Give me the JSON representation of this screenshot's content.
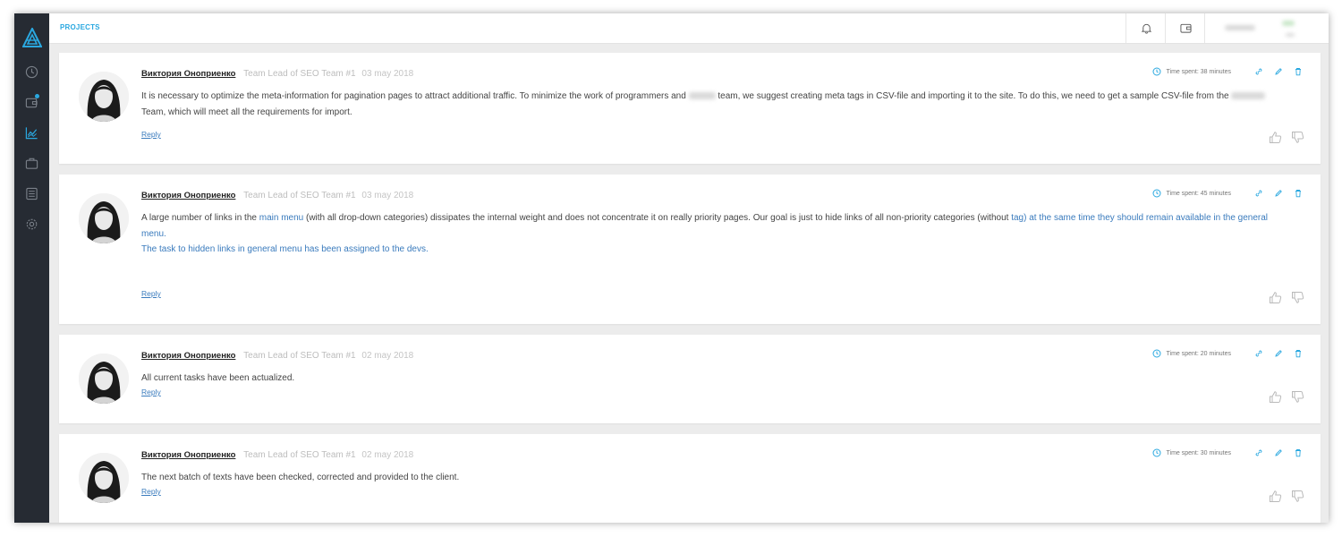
{
  "app": {
    "section_title": "PROJECTS",
    "accent_color": "#2aa8e0",
    "sidebar_bg": "#262b33"
  },
  "sidebar": {
    "items": [
      {
        "icon": "logo-icon"
      },
      {
        "icon": "clock-icon"
      },
      {
        "icon": "wallet-icon"
      },
      {
        "icon": "chart-icon",
        "active": true
      },
      {
        "icon": "briefcase-icon"
      },
      {
        "icon": "list-icon"
      },
      {
        "icon": "gear-icon"
      }
    ]
  },
  "topbar": {
    "icons": [
      "bell-icon",
      "wallet-icon"
    ]
  },
  "comments": [
    {
      "author": "Виктория Оноприенко",
      "role": "Team Lead of SEO Team #1",
      "date": "03 may 2018",
      "time_spent": "Time spent: 38 minutes",
      "text_parts": {
        "p1": "It is necessary to optimize the meta-information for pagination pages to attract additional traffic. To minimize the work of programmers and",
        "p2": "team, we suggest creating meta tags in CSV-file and importing it to the site. To do this, we need to get a sample CSV-file from the",
        "p3": "Team, which will meet all the requirements for import."
      },
      "reply": "Reply"
    },
    {
      "author": "Виктория Оноприенко",
      "role": "Team Lead of SEO Team #1",
      "date": "03 may 2018",
      "time_spent": "Time spent: 45 minutes",
      "text_parts": {
        "p1": "A large number of links in the",
        "link1": "main menu",
        "p2": "(with all drop-down categories) dissipates the internal weight and does not concentrate it on really priority pages. Our goal is just to hide links of all non-priority categories (without",
        "link2": "tag",
        "p3": ") at the same time they should remain available in the general menu.",
        "p4": "The task to hidden links in general menu has been assigned to the devs."
      },
      "reply": "Reply"
    },
    {
      "author": "Виктория Оноприенко",
      "role": "Team Lead of SEO Team #1",
      "date": "02 may 2018",
      "time_spent": "Time spent: 20 minutes",
      "text_parts": {
        "p1": "All current tasks have been actualized."
      },
      "reply": "Reply"
    },
    {
      "author": "Виктория Оноприенко",
      "role": "Team Lead of SEO Team #1",
      "date": "02 may 2018",
      "time_spent": "Time spent: 30 minutes",
      "text_parts": {
        "p1": "The next batch of texts have been checked, corrected and provided to the client."
      },
      "reply": "Reply"
    }
  ]
}
